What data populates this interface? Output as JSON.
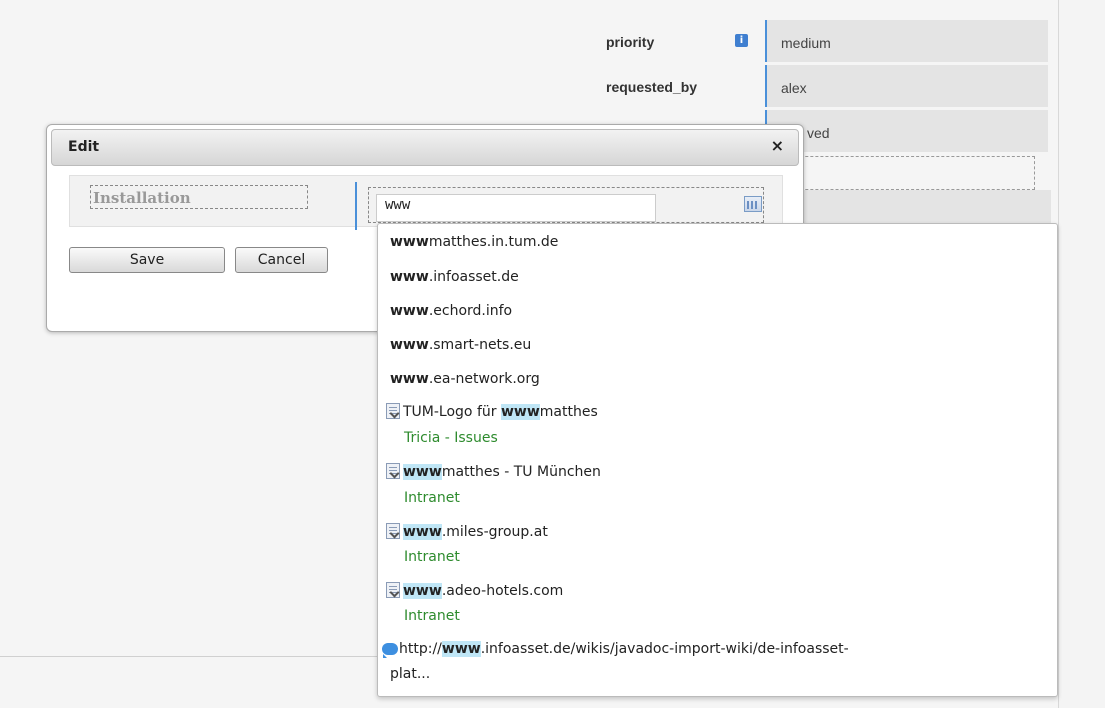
{
  "properties": [
    {
      "label": "priority",
      "value": "medium",
      "info_icon": "info-icon"
    },
    {
      "label": "requested_by",
      "value": "alex"
    },
    {
      "label": "",
      "value": "ved"
    }
  ],
  "dialog": {
    "title": "Edit",
    "close_label": "×",
    "field_label": "Installation",
    "input_value": "www",
    "save_label": "Save",
    "cancel_label": "Cancel"
  },
  "suggestions": {
    "urls": [
      {
        "match": "www",
        "rest": "matthes.in.tum.de"
      },
      {
        "match": "www",
        "rest": ".infoasset.de"
      },
      {
        "match": "www",
        "rest": ".echord.info"
      },
      {
        "match": "www",
        "rest": ".smart-nets.eu"
      },
      {
        "match": "www",
        "rest": ".ea-network.org"
      }
    ],
    "documents": [
      {
        "pre": "TUM-Logo für ",
        "match": "www",
        "rest": "matthes",
        "source": "Tricia - Issues"
      },
      {
        "pre": "",
        "match": "www",
        "rest": "matthes - TU München",
        "source": "Intranet"
      },
      {
        "pre": "",
        "match": "www",
        "rest": ".miles-group.at",
        "source": "Intranet"
      },
      {
        "pre": "",
        "match": "www",
        "rest": ".adeo-hotels.com",
        "source": "Intranet"
      }
    ],
    "wiki": {
      "pre": "http://",
      "match": "www",
      "rest": ".infoasset.de/wikis/javadoc-import-wiki/de-infoasset-",
      "cont": "plat..."
    }
  },
  "colors": {
    "accent": "#4a90d9",
    "highlight": "#bfe6f6",
    "source_text": "#2e8b2e"
  }
}
